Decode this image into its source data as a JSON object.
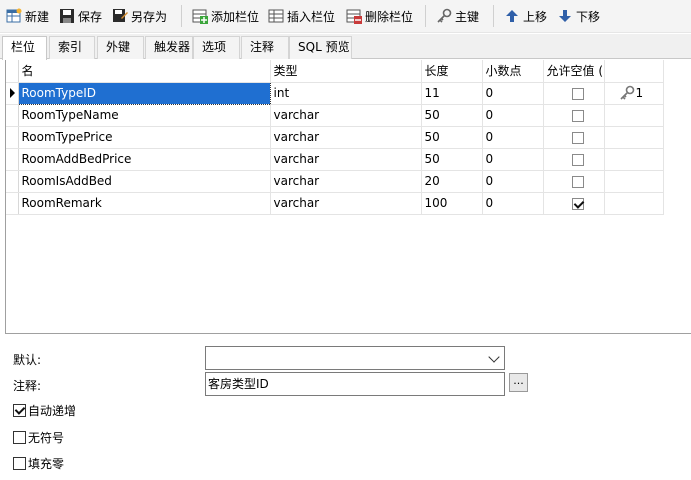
{
  "toolbar": {
    "new": "新建",
    "save": "保存",
    "save_as": "另存为",
    "add_field": "添加栏位",
    "insert_field": "插入栏位",
    "delete_field": "删除栏位",
    "primary_key": "主键",
    "move_up": "上移",
    "move_down": "下移"
  },
  "tabs": [
    "栏位",
    "索引",
    "外键",
    "触发器",
    "选项",
    "注释",
    "SQL 预览"
  ],
  "active_tab": "栏位",
  "grid": {
    "columns": [
      "名",
      "类型",
      "长度",
      "小数点",
      "允许空值 (",
      ""
    ],
    "rows": [
      {
        "name": "RoomTypeID",
        "type": "int",
        "length": "11",
        "decimals": "0",
        "nullable": false,
        "key": "1",
        "selected": true
      },
      {
        "name": "RoomTypeName",
        "type": "varchar",
        "length": "50",
        "decimals": "0",
        "nullable": false,
        "key": "",
        "selected": false
      },
      {
        "name": "RoomTypePrice",
        "type": "varchar",
        "length": "50",
        "decimals": "0",
        "nullable": false,
        "key": "",
        "selected": false
      },
      {
        "name": "RoomAddBedPrice",
        "type": "varchar",
        "length": "50",
        "decimals": "0",
        "nullable": false,
        "key": "",
        "selected": false
      },
      {
        "name": "RoomIsAddBed",
        "type": "varchar",
        "length": "20",
        "decimals": "0",
        "nullable": false,
        "key": "",
        "selected": false
      },
      {
        "name": "RoomRemark",
        "type": "varchar",
        "length": "100",
        "decimals": "0",
        "nullable": true,
        "key": "",
        "selected": false
      }
    ]
  },
  "properties": {
    "default_label": "默认:",
    "default_value": "",
    "comment_label": "注释:",
    "comment_value": "客房类型ID",
    "ellipsis": "...",
    "auto_increment_label": "自动递增",
    "auto_increment": true,
    "unsigned_label": "无符号",
    "unsigned": false,
    "zerofill_label": "填充零",
    "zerofill": false
  },
  "colors": {
    "selection": "#1f6fd1",
    "toolbar_bg": "#f4f4f4"
  }
}
